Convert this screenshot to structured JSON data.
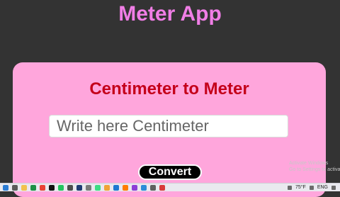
{
  "app": {
    "title": "Meter App"
  },
  "card": {
    "title": "Centimeter to Meter",
    "input_placeholder": "Write here Centimeter",
    "input_value": "",
    "convert_label": "Convert"
  },
  "watermark": {
    "line1": "Activate Windows",
    "line2": "Go to Settings to activate"
  },
  "taskbar": {
    "apps": [
      {
        "name": "start-icon",
        "color": "#2a7bd3"
      },
      {
        "name": "search-icon",
        "color": "#5a5a5a"
      },
      {
        "name": "file-explorer-icon",
        "color": "#f2c14e"
      },
      {
        "name": "excel-icon",
        "color": "#1d8f45"
      },
      {
        "name": "chrome-icon",
        "color": "#e84235"
      },
      {
        "name": "tiktok-icon",
        "color": "#111111"
      },
      {
        "name": "whatsapp-icon",
        "color": "#22c35e"
      },
      {
        "name": "camera-icon",
        "color": "#4c4c4c"
      },
      {
        "name": "photoshop-icon",
        "color": "#1f3b73"
      },
      {
        "name": "store-icon",
        "color": "#7a7a7a"
      },
      {
        "name": "android-icon",
        "color": "#3ddc84"
      },
      {
        "name": "folder-icon",
        "color": "#f0a336"
      },
      {
        "name": "vscode-icon",
        "color": "#1f78d1"
      },
      {
        "name": "illustrator-icon",
        "color": "#ff7c00"
      },
      {
        "name": "app-icon",
        "color": "#8c3fd6"
      },
      {
        "name": "edge-icon",
        "color": "#2c8bd8"
      },
      {
        "name": "settings-icon",
        "color": "#5f5f5f"
      },
      {
        "name": "media-icon",
        "color": "#d83a3a"
      }
    ],
    "temperature": "75°F",
    "language": "ENG"
  }
}
